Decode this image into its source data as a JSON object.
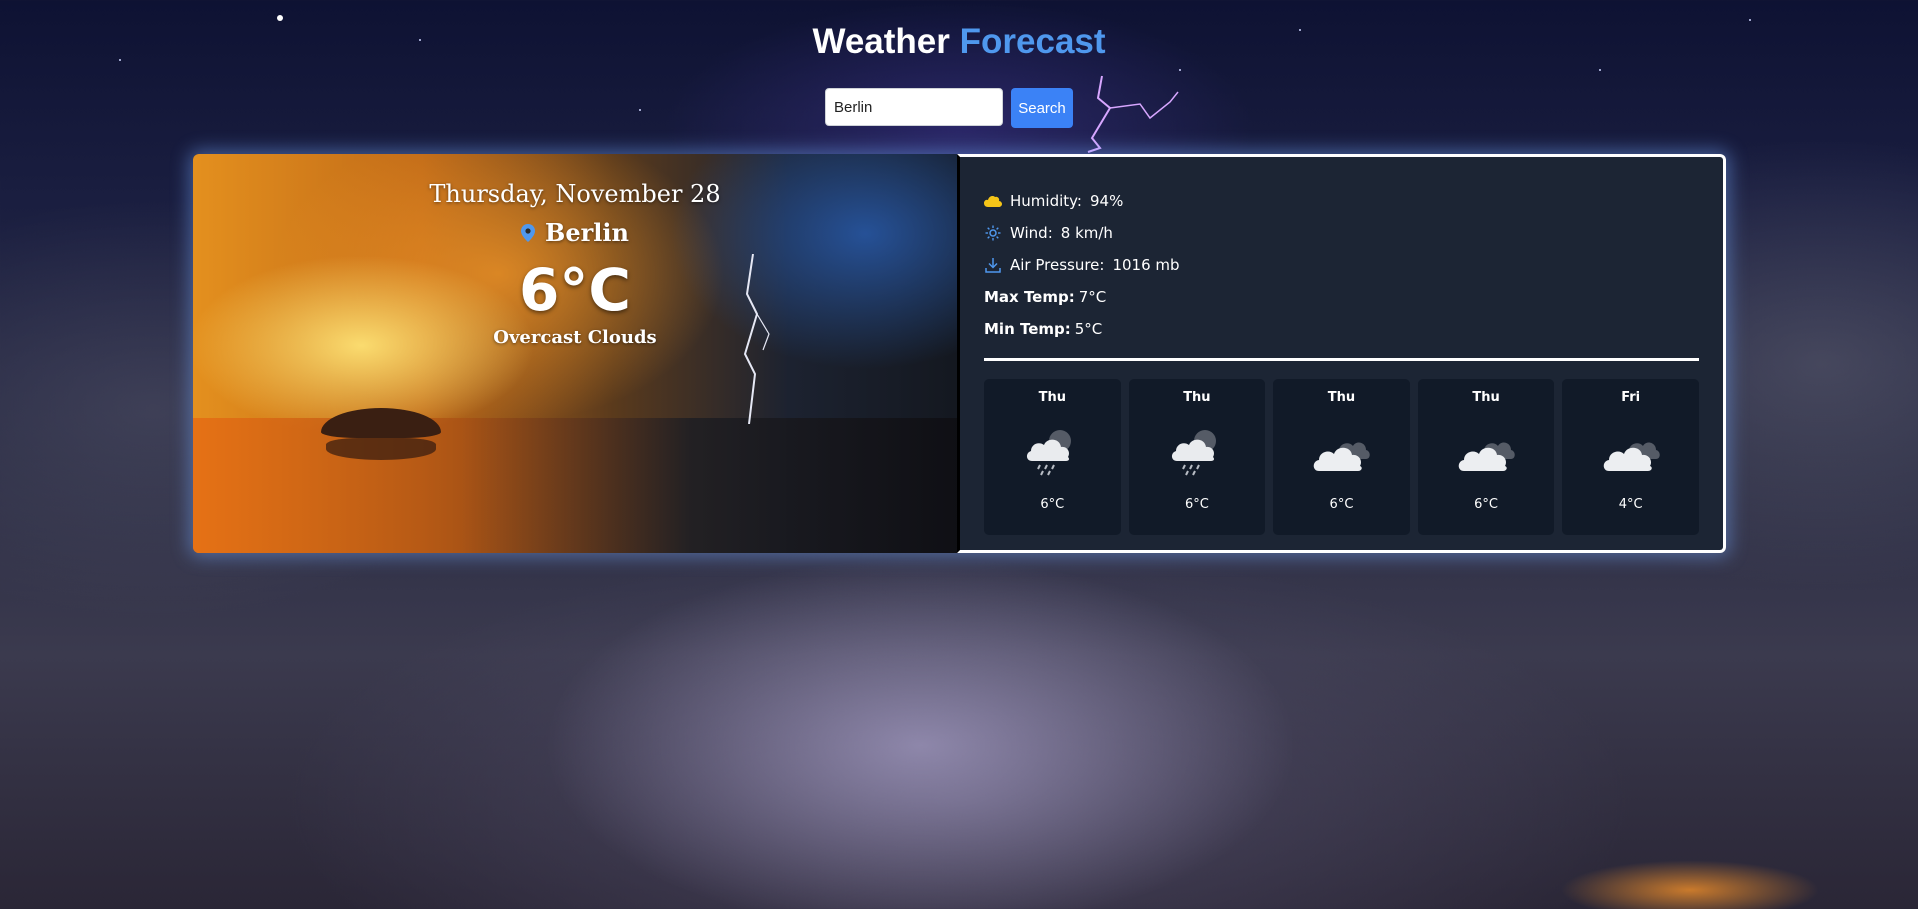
{
  "header": {
    "title_part1": "Weather",
    "title_part2": "Forecast"
  },
  "search": {
    "value": "Berlin",
    "button_label": "Search"
  },
  "current": {
    "date": "Thursday, November 28",
    "location": "Berlin",
    "temperature": "6°C",
    "condition": "Overcast Clouds"
  },
  "details": {
    "humidity_label": "Humidity:",
    "humidity_value": "94%",
    "wind_label": "Wind:",
    "wind_value": "8 km/h",
    "pressure_label": "Air Pressure:",
    "pressure_value": "1016 mb",
    "max_label": "Max Temp:",
    "max_value": "7°C",
    "min_label": "Min Temp:",
    "min_value": "5°C"
  },
  "forecast": [
    {
      "day": "Thu",
      "icon": "rain-cloud-icon",
      "temp": "6°C"
    },
    {
      "day": "Thu",
      "icon": "rain-cloud-icon",
      "temp": "6°C"
    },
    {
      "day": "Thu",
      "icon": "overcast-cloud-icon",
      "temp": "6°C"
    },
    {
      "day": "Thu",
      "icon": "overcast-cloud-icon",
      "temp": "6°C"
    },
    {
      "day": "Fri",
      "icon": "overcast-cloud-icon",
      "temp": "4°C"
    }
  ],
  "colors": {
    "accent": "#4f98ee",
    "button": "#3b82f6",
    "panel": "#1c2534",
    "forecast_tile": "#111a28",
    "humidity_icon": "#f5c518",
    "wind_icon": "#4f98ee"
  }
}
